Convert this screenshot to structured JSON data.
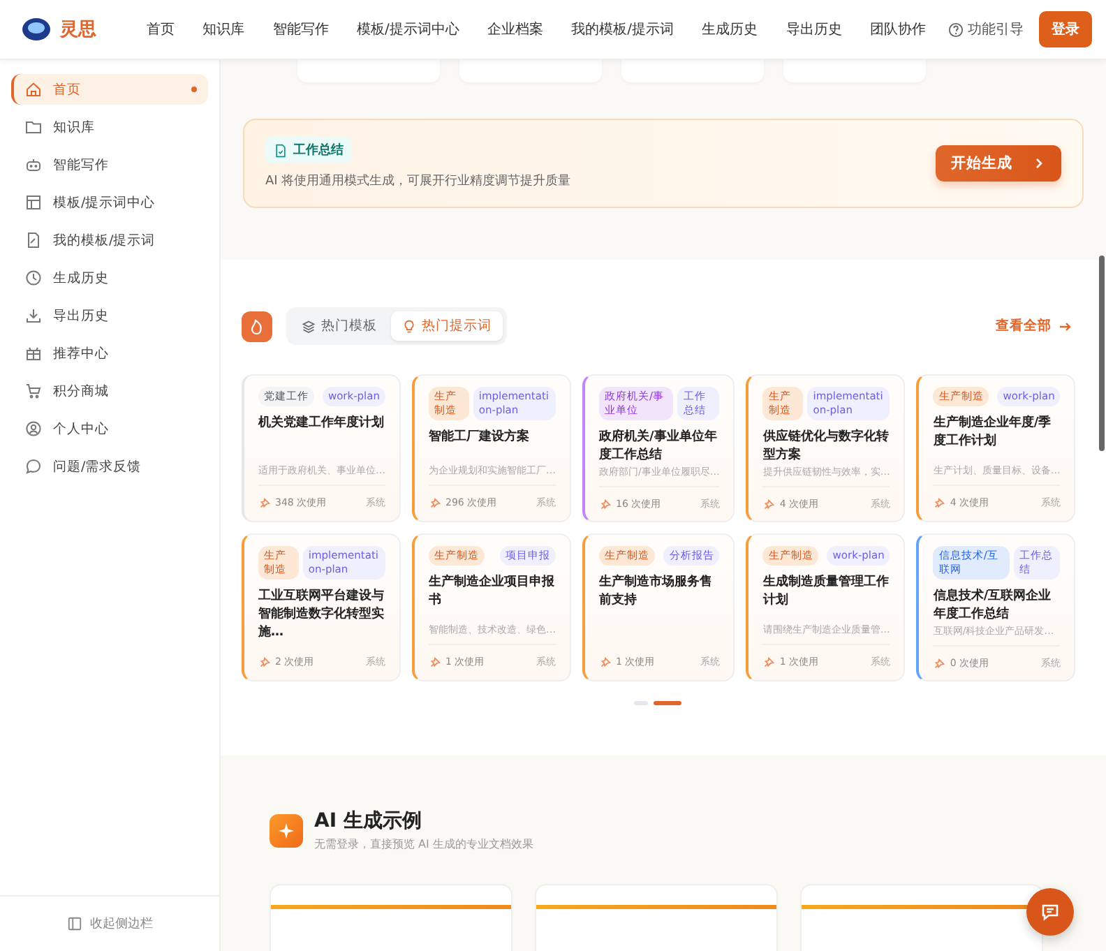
{
  "header": {
    "brand": "灵思",
    "nav": [
      {
        "label": "首页",
        "selected": false
      },
      {
        "label": "知识库",
        "selected": false
      },
      {
        "label": "智能写作",
        "selected": false
      },
      {
        "label": "模板/提示词中心",
        "selected": false
      },
      {
        "label": "企业档案",
        "selected": false
      },
      {
        "label": "我的模板/提示词",
        "selected": false
      },
      {
        "label": "生成历史",
        "selected": false
      },
      {
        "label": "导出历史",
        "selected": false
      },
      {
        "label": "团队协作",
        "selected": false
      }
    ],
    "guide": "功能引导",
    "login": "登录"
  },
  "sidebar": {
    "items": [
      {
        "label": "首页",
        "selected": true
      },
      {
        "label": "知识库",
        "selected": false
      },
      {
        "label": "智能写作",
        "selected": false
      },
      {
        "label": "模板/提示词中心",
        "selected": false
      },
      {
        "label": "我的模板/提示词",
        "selected": false
      },
      {
        "label": "生成历史",
        "selected": false
      },
      {
        "label": "导出历史",
        "selected": false
      },
      {
        "label": "推荐中心",
        "selected": false
      },
      {
        "label": "积分商城",
        "selected": false
      },
      {
        "label": "个人中心",
        "selected": false
      },
      {
        "label": "问题/需求反馈",
        "selected": false
      }
    ],
    "collapse": "收起侧边栏"
  },
  "banner": {
    "tag": "工作总结",
    "text": "AI 将使用通用模式生成，可展开行业精度调节提升质量",
    "button": "开始生成"
  },
  "hot": {
    "tabs": [
      {
        "label": "热门模板",
        "selected": false
      },
      {
        "label": "热门提示词",
        "selected": true
      }
    ],
    "view_all": "查看全部",
    "cards": [
      {
        "tag": {
          "label": "党建工作",
          "color": "#f3f4f6"
        },
        "type": "work-plan",
        "title": "机关党建工作年度计划",
        "desc": "适用于政府机关、事业单位…",
        "uses": "348 次使用",
        "source": "系统",
        "color": "#e5e7eb"
      },
      {
        "tag": {
          "label": "生产制造",
          "color": "#fde8d6"
        },
        "type": "implementation-plan",
        "title": "智能工厂建设方案",
        "desc": "为企业规划和实施智能工厂…",
        "uses": "296 次使用",
        "source": "系统",
        "color": "#f59e3b"
      },
      {
        "tag": {
          "label": "政府机关/事业单位",
          "color": "#f1e4fb"
        },
        "type": "工作总结",
        "title": "政府机关/事业单位年度工作总结",
        "desc": "政府部门/事业单位履职尽…",
        "uses": "16 次使用",
        "source": "系统",
        "color": "#c084fc"
      },
      {
        "tag": {
          "label": "生产制造",
          "color": "#fde8d6"
        },
        "type": "implementation-plan",
        "title": "供应链优化与数字化转型方案",
        "desc": "提升供应链韧性与效率，实…",
        "uses": "4 次使用",
        "source": "系统",
        "color": "#f59e3b"
      },
      {
        "tag": {
          "label": "生产制造",
          "color": "#fde8d6"
        },
        "type": "work-plan",
        "title": "生产制造企业年度/季度工作计划",
        "desc": "生产计划、质量目标、设备…",
        "uses": "4 次使用",
        "source": "系统",
        "color": "#f59e3b"
      },
      {
        "tag": {
          "label": "生产制造",
          "color": "#fde8d6"
        },
        "type": "implementation-plan",
        "title": "工业互联网平台建设与智能制造数字化转型实施…",
        "uses": "2 次使用",
        "source": "系统",
        "color": "#f59e3b"
      },
      {
        "tag": {
          "label": "生产制造",
          "color": "#fde8d6"
        },
        "type": "项目申报",
        "title": "生产制造企业项目申报书",
        "desc": "智能制造、技术改造、绿色…",
        "uses": "1 次使用",
        "source": "系统",
        "color": "#f59e3b"
      },
      {
        "tag": {
          "label": "生产制造",
          "color": "#fde8d6"
        },
        "type": "分析报告",
        "title": "生产制造市场服务售前支持",
        "uses": "1 次使用",
        "source": "系统",
        "color": "#f59e3b"
      },
      {
        "tag": {
          "label": "生产制造",
          "color": "#fde8d6"
        },
        "type": "work-plan",
        "title": "生成制造质量管理工作计划",
        "desc": "请围绕生产制造企业质量管…",
        "uses": "1 次使用",
        "source": "系统",
        "color": "#f59e3b"
      },
      {
        "tag": {
          "label": "信息技术/互联网",
          "color": "#e0ecfd"
        },
        "type": "工作总结",
        "title": "信息技术/互联网企业年度工作总结",
        "desc": "互联网/科技企业产品研发…",
        "uses": "0 次使用",
        "source": "系统",
        "color": "#60a5fa"
      }
    ],
    "pages": [
      {
        "selected": false
      },
      {
        "selected": true
      }
    ]
  },
  "examples": {
    "title": "AI 生成示例",
    "subtitle": "无需登录，直接预览 AI 生成的专业文档效果"
  }
}
